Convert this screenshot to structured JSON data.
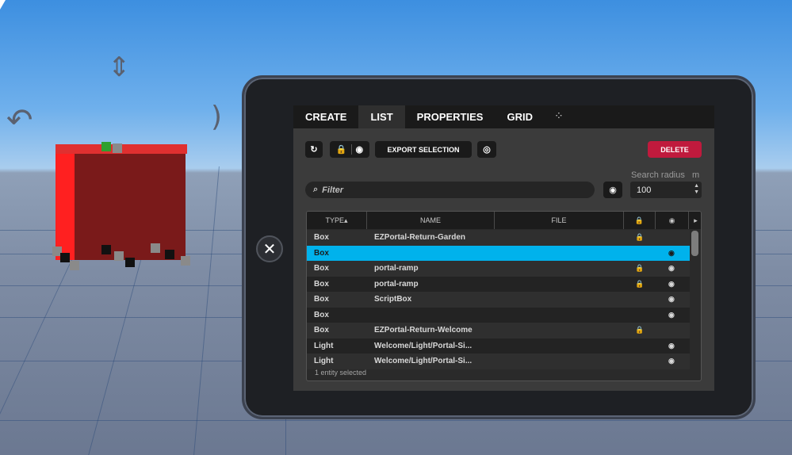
{
  "tabs": [
    {
      "label": "CREATE"
    },
    {
      "label": "LIST"
    },
    {
      "label": "PROPERTIES"
    },
    {
      "label": "GRID"
    }
  ],
  "toolbar": {
    "export_label": "EXPORT SELECTION",
    "delete_label": "DELETE"
  },
  "search": {
    "filter_placeholder": "Filter",
    "radius_label": "Search radius",
    "radius_unit": "m",
    "radius_value": "100"
  },
  "table": {
    "headers": {
      "type": "TYPE▴",
      "name": "NAME",
      "file": "FILE"
    },
    "rows": [
      {
        "type": "Box",
        "name": "EZPortal-Return-Garden",
        "locked": true,
        "visible": false
      },
      {
        "type": "Box",
        "name": "",
        "locked": false,
        "visible": true,
        "selected": true
      },
      {
        "type": "Box",
        "name": "portal-ramp",
        "locked": true,
        "visible": true
      },
      {
        "type": "Box",
        "name": "portal-ramp",
        "locked": true,
        "visible": true
      },
      {
        "type": "Box",
        "name": "ScriptBox",
        "locked": false,
        "visible": true
      },
      {
        "type": "Box",
        "name": "",
        "locked": false,
        "visible": true
      },
      {
        "type": "Box",
        "name": "EZPortal-Return-Welcome",
        "locked": true,
        "visible": false
      },
      {
        "type": "Light",
        "name": "Welcome/Light/Portal-Si...",
        "locked": false,
        "visible": true
      },
      {
        "type": "Light",
        "name": "Welcome/Light/Portal-Si...",
        "locked": false,
        "visible": true
      }
    ],
    "status": "1 entity selected"
  },
  "colors": {
    "accent": "#00b2ec",
    "delete": "#c01a3d"
  }
}
